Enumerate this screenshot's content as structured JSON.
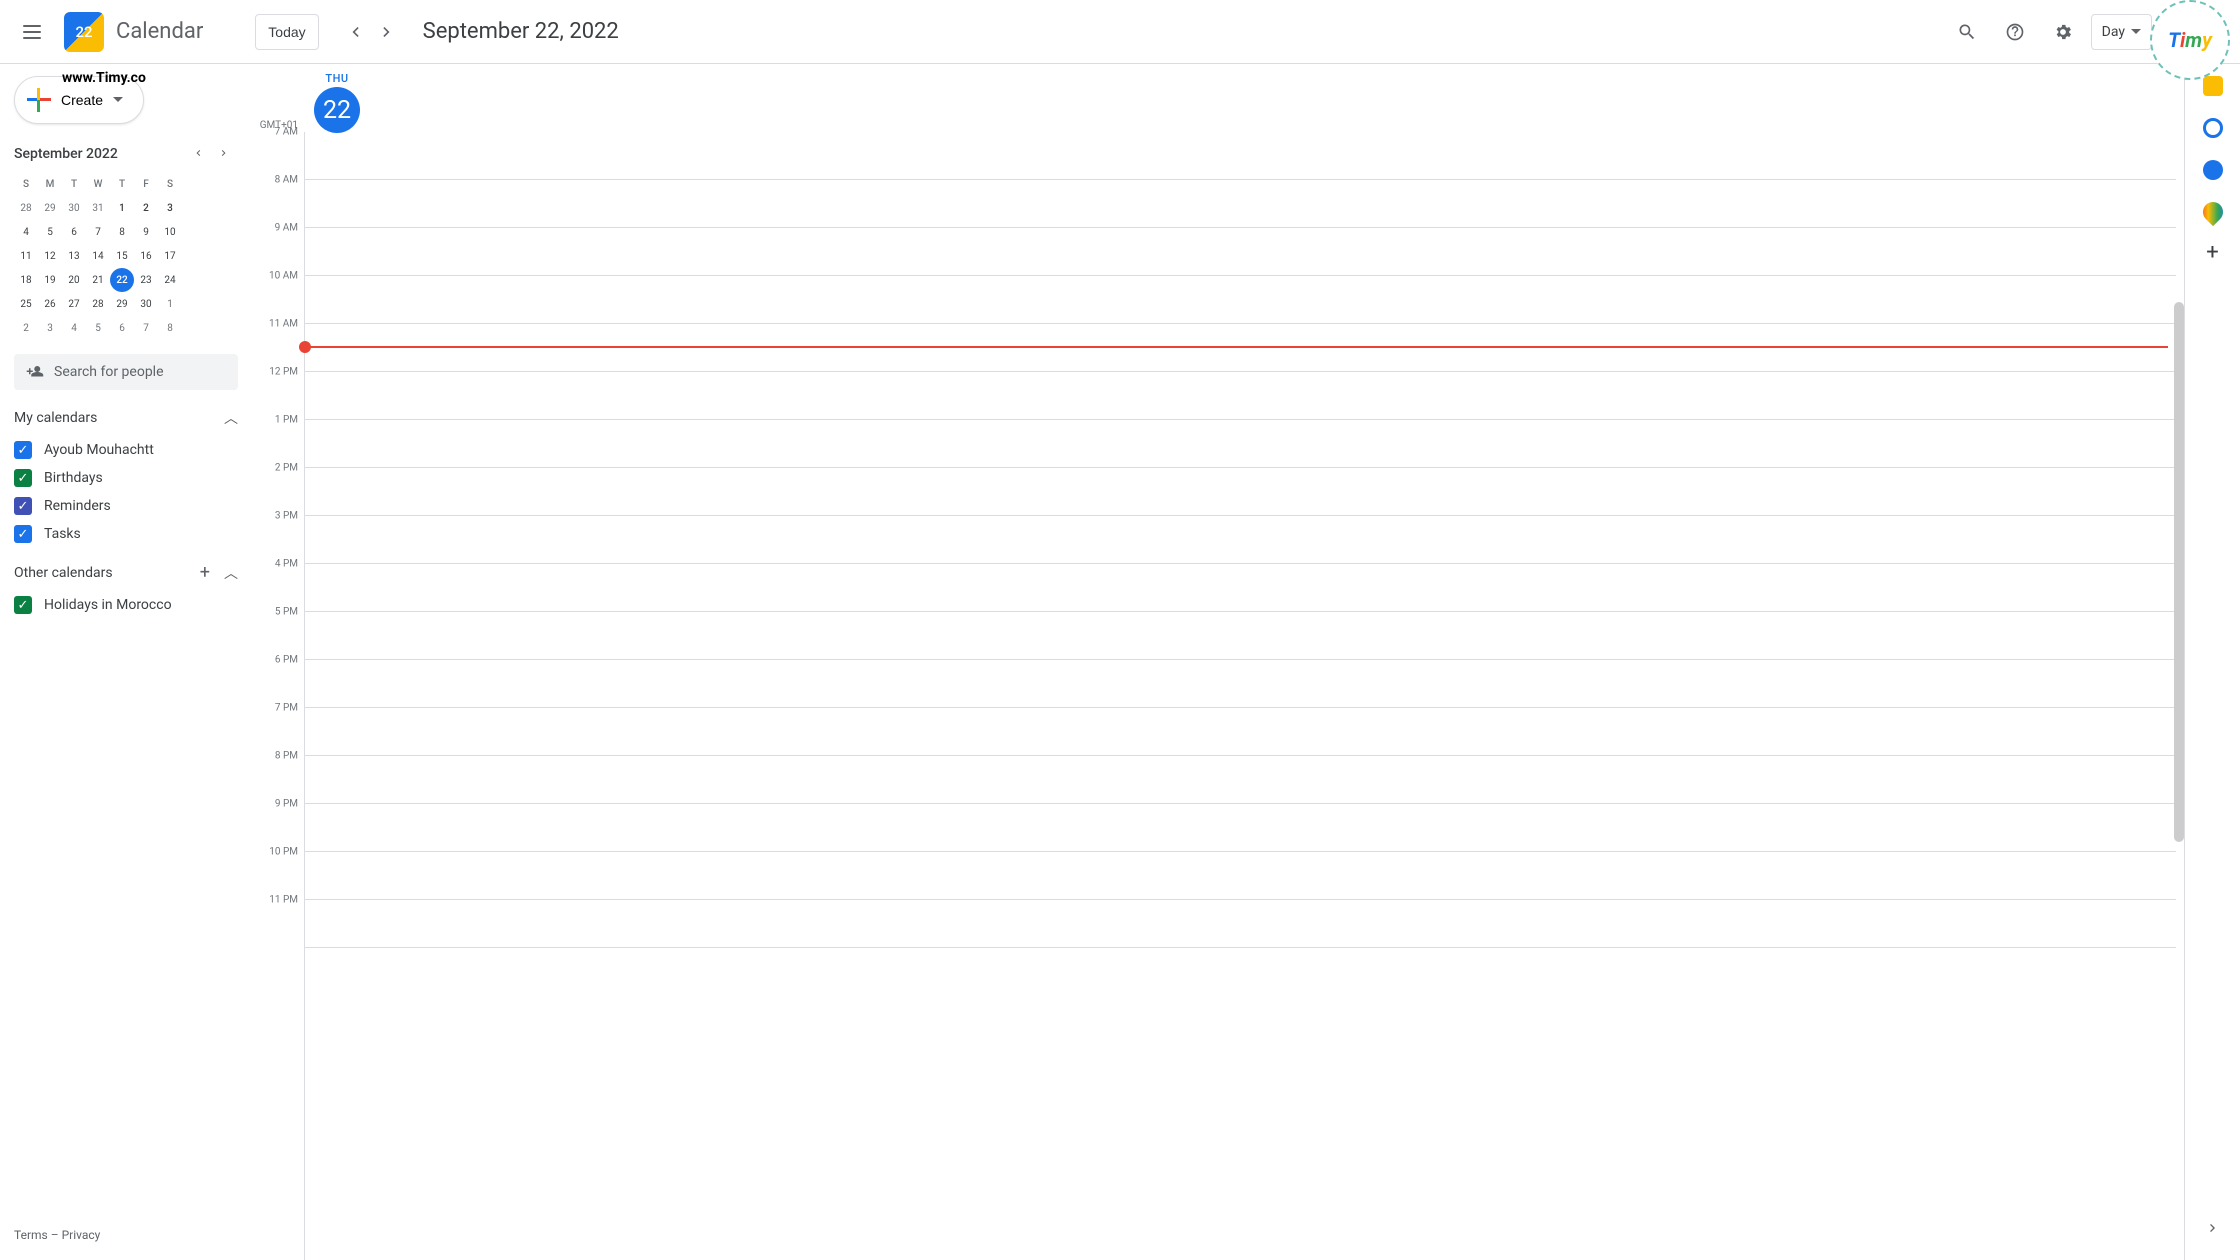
{
  "header": {
    "app_name": "Calendar",
    "logo_day": "22",
    "today_label": "Today",
    "date_title": "September 22, 2022",
    "view_label": "Day"
  },
  "overlay_url": "www.Timy.co",
  "timy_logo_letters": [
    "T",
    "i",
    "m",
    "y"
  ],
  "create_label": "Create",
  "mini_cal": {
    "title": "September 2022",
    "dow": [
      "S",
      "M",
      "T",
      "W",
      "T",
      "F",
      "S"
    ],
    "cells": [
      {
        "n": "28",
        "m": "prev"
      },
      {
        "n": "29",
        "m": "prev"
      },
      {
        "n": "30",
        "m": "prev"
      },
      {
        "n": "31",
        "m": "prev"
      },
      {
        "n": "1",
        "m": "cur",
        "b": true
      },
      {
        "n": "2",
        "m": "cur",
        "b": true
      },
      {
        "n": "3",
        "m": "cur",
        "b": true
      },
      {
        "n": "4",
        "m": "cur"
      },
      {
        "n": "5",
        "m": "cur"
      },
      {
        "n": "6",
        "m": "cur"
      },
      {
        "n": "7",
        "m": "cur"
      },
      {
        "n": "8",
        "m": "cur"
      },
      {
        "n": "9",
        "m": "cur"
      },
      {
        "n": "10",
        "m": "cur"
      },
      {
        "n": "11",
        "m": "cur"
      },
      {
        "n": "12",
        "m": "cur"
      },
      {
        "n": "13",
        "m": "cur"
      },
      {
        "n": "14",
        "m": "cur"
      },
      {
        "n": "15",
        "m": "cur"
      },
      {
        "n": "16",
        "m": "cur"
      },
      {
        "n": "17",
        "m": "cur"
      },
      {
        "n": "18",
        "m": "cur"
      },
      {
        "n": "19",
        "m": "cur"
      },
      {
        "n": "20",
        "m": "cur"
      },
      {
        "n": "21",
        "m": "cur"
      },
      {
        "n": "22",
        "m": "today"
      },
      {
        "n": "23",
        "m": "cur"
      },
      {
        "n": "24",
        "m": "cur"
      },
      {
        "n": "25",
        "m": "cur"
      },
      {
        "n": "26",
        "m": "cur"
      },
      {
        "n": "27",
        "m": "cur"
      },
      {
        "n": "28",
        "m": "cur"
      },
      {
        "n": "29",
        "m": "cur"
      },
      {
        "n": "30",
        "m": "cur"
      },
      {
        "n": "1",
        "m": "next"
      },
      {
        "n": "2",
        "m": "next"
      },
      {
        "n": "3",
        "m": "next"
      },
      {
        "n": "4",
        "m": "next"
      },
      {
        "n": "5",
        "m": "next"
      },
      {
        "n": "6",
        "m": "next"
      },
      {
        "n": "7",
        "m": "next"
      },
      {
        "n": "8",
        "m": "next"
      }
    ]
  },
  "search_people_placeholder": "Search for people",
  "my_calendars_label": "My calendars",
  "my_calendars": [
    {
      "label": "Ayoub Mouhachtt",
      "color": "#1a73e8"
    },
    {
      "label": "Birthdays",
      "color": "#0b8043"
    },
    {
      "label": "Reminders",
      "color": "#3f51b5"
    },
    {
      "label": "Tasks",
      "color": "#1a73e8"
    }
  ],
  "other_calendars_label": "Other calendars",
  "other_calendars": [
    {
      "label": "Holidays in Morocco",
      "color": "#0b8043"
    }
  ],
  "footer": {
    "terms": "Terms",
    "sep": " – ",
    "privacy": "Privacy"
  },
  "day_view": {
    "tz": "GMT+01",
    "dow": "THU",
    "day_num": "22",
    "hours": [
      "7 AM",
      "8 AM",
      "9 AM",
      "10 AM",
      "11 AM",
      "12 PM",
      "1 PM",
      "2 PM",
      "3 PM",
      "4 PM",
      "5 PM",
      "6 PM",
      "7 PM",
      "8 PM",
      "9 PM",
      "10 PM",
      "11 PM"
    ],
    "now_after_hour_index": 4,
    "now_fraction": 0.45
  },
  "side_panel": {
    "icons": [
      {
        "name": "keep-icon",
        "color": "#fbbc04"
      },
      {
        "name": "tasks-icon",
        "color": "#1a73e8"
      },
      {
        "name": "contacts-icon",
        "color": "#1a73e8"
      },
      {
        "name": "maps-icon",
        "color": "#34a853"
      }
    ]
  }
}
